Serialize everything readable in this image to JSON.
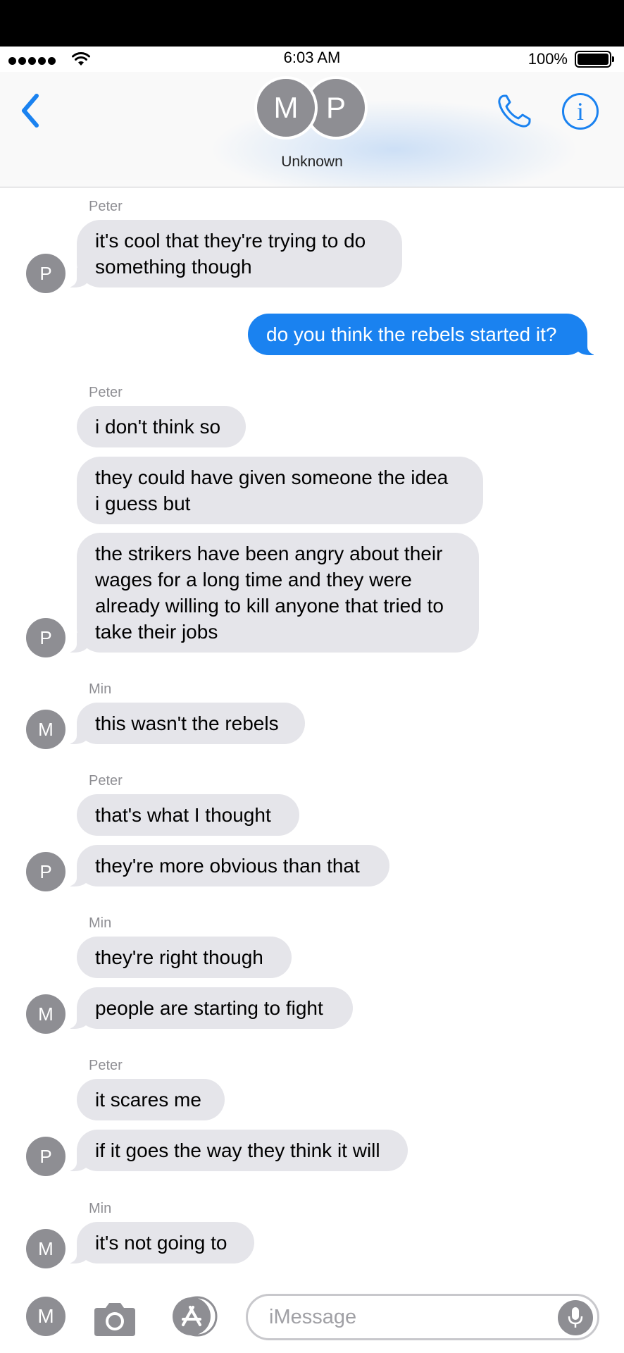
{
  "status": {
    "time": "6:03 AM",
    "battery": "100%"
  },
  "header": {
    "avatar_m": "M",
    "avatar_p": "P",
    "title": "Unknown"
  },
  "conversation": {
    "sender_1": "Peter",
    "msg_1": "it's cool that they're trying to do",
    "msg_1b": "something though",
    "out_1": "do you think the rebels started it?",
    "sender_2": "Peter",
    "msg_2": "i don't think so",
    "msg_3a": "they could have given someone the idea",
    "msg_3b": "i guess but",
    "msg_4a": "the strikers have been angry about their",
    "msg_4b": "wages for a long time and they were",
    "msg_4c": "already willing to kill anyone that tried to",
    "msg_4d": "take their jobs",
    "sender_3": "Min",
    "msg_5": "this wasn't the rebels",
    "sender_4": "Peter",
    "msg_6": "that's what I thought",
    "msg_7": "they're more obvious than that",
    "sender_5": "Min",
    "msg_8": "they're right though",
    "msg_9": "people are starting to fight",
    "sender_6": "Peter",
    "msg_10": "it scares me",
    "msg_11": "if it goes the way they think it will",
    "sender_7": "Min",
    "msg_12": "it's not going to",
    "avatar_p": "P",
    "avatar_m": "M"
  },
  "input": {
    "avatar": "M",
    "placeholder": "iMessage"
  },
  "colors": {
    "accent": "#1a82f0",
    "bubble_in": "#e5e5ea",
    "avatar": "#8e8e93"
  },
  "icons": [
    "signal-dots",
    "wifi-icon",
    "battery-icon",
    "back-chevron-icon",
    "phone-icon",
    "info-icon",
    "camera-icon",
    "app-store-icon",
    "microphone-icon"
  ]
}
